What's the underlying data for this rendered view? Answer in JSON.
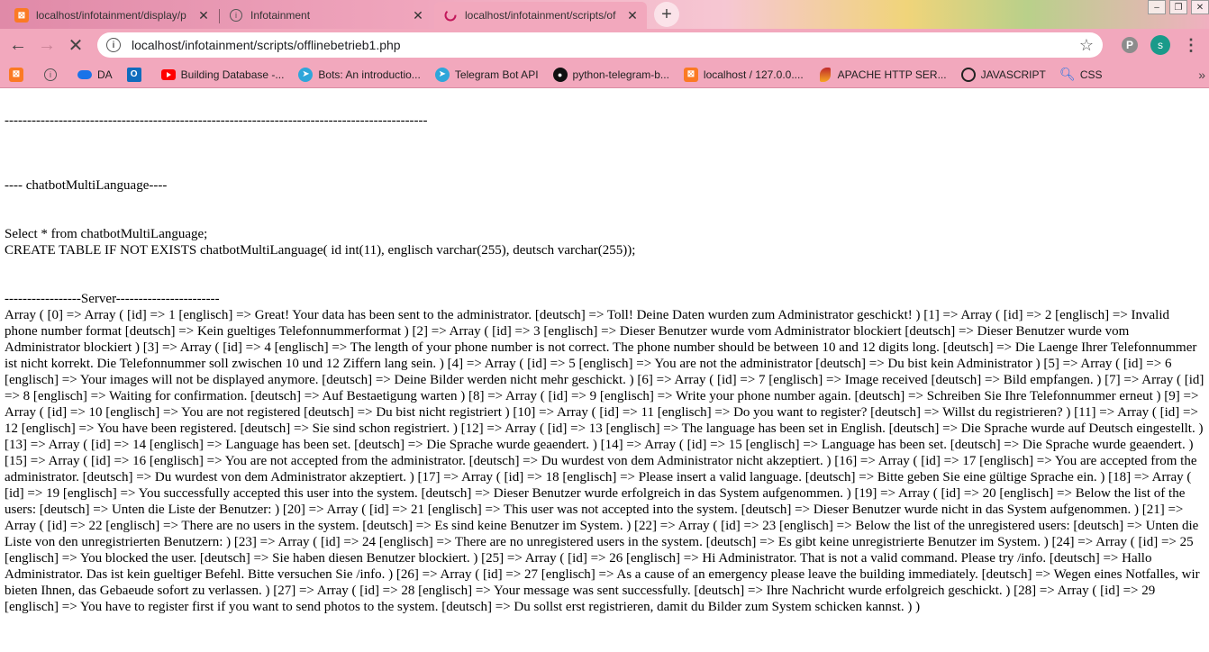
{
  "tabs": [
    {
      "title": "localhost/infotainment/display/p",
      "icon": "xampp-icon"
    },
    {
      "title": "Infotainment",
      "icon": "info-icon"
    },
    {
      "title": "localhost/infotainment/scripts/of",
      "icon": "loading-icon"
    }
  ],
  "toolbar": {
    "url": "localhost/infotainment/scripts/offlinebetrieb1.php",
    "avatar_letter": "s"
  },
  "bookmarks": [
    {
      "label": "",
      "icon": "xampp-icon"
    },
    {
      "label": "",
      "icon": "info-icon"
    },
    {
      "label": "DA",
      "icon": "cloud-icon"
    },
    {
      "label": "",
      "icon": "outlook-icon"
    },
    {
      "label": "Building Database -...",
      "icon": "youtube-icon"
    },
    {
      "label": "Bots: An introductio...",
      "icon": "telegram-icon"
    },
    {
      "label": "Telegram Bot API",
      "icon": "telegram-icon"
    },
    {
      "label": "python-telegram-b...",
      "icon": "github-icon"
    },
    {
      "label": "localhost / 127.0.0....",
      "icon": "xampp-icon"
    },
    {
      "label": "APACHE HTTP SER...",
      "icon": "apache-icon"
    },
    {
      "label": "JAVASCRIPT",
      "icon": "js-icon"
    },
    {
      "label": "CSS",
      "icon": "search-icon"
    }
  ],
  "page": {
    "separator": "----------------------------------------------------------------------------------------------",
    "section_title": "---- chatbotMultiLanguage----",
    "query_select": "Select * from chatbotMultiLanguage;",
    "query_create": "CREATE TABLE IF NOT EXISTS chatbotMultiLanguage( id int(11), englisch varchar(255), deutsch varchar(255));",
    "server_label": "-----------------Server-----------------------",
    "server_output": "Array ( [0] => Array ( [id] => 1 [englisch] => Great! Your data has been sent to the administrator. [deutsch] => Toll! Deine Daten wurden zum Administrator geschickt! ) [1] => Array ( [id] => 2 [englisch] => Invalid phone number format [deutsch] => Kein gueltiges Telefonnummerformat ) [2] => Array ( [id] => 3 [englisch] => Dieser Benutzer wurde vom Administrator blockiert [deutsch] => Dieser Benutzer wurde vom Administrator blockiert ) [3] => Array ( [id] => 4 [englisch] => The length of your phone number is not correct. The phone number should be between 10 and 12 digits long. [deutsch] => Die Laenge Ihrer Telefonnummer ist nicht korrekt. Die Telefonnummer soll zwischen 10 und 12 Ziffern lang sein. ) [4] => Array ( [id] => 5 [englisch] => You are not the administrator [deutsch] => Du bist kein Administrator ) [5] => Array ( [id] => 6 [englisch] => Your images will not be displayed anymore. [deutsch] => Deine Bilder werden nicht mehr geschickt. ) [6] => Array ( [id] => 7 [englisch] => Image received [deutsch] => Bild empfangen. ) [7] => Array ( [id] => 8 [englisch] => Waiting for confirmation. [deutsch] => Auf Bestaetigung warten ) [8] => Array ( [id] => 9 [englisch] => Write your phone number again. [deutsch] => Schreiben Sie Ihre Telefonnummer erneut ) [9] => Array ( [id] => 10 [englisch] => You are not registered [deutsch] => Du bist nicht registriert ) [10] => Array ( [id] => 11 [englisch] => Do you want to register? [deutsch] => Willst du registrieren? ) [11] => Array ( [id] => 12 [englisch] => You have been registered. [deutsch] => Sie sind schon registriert. ) [12] => Array ( [id] => 13 [englisch] => The language has been set in English. [deutsch] => Die Sprache wurde auf Deutsch eingestellt. ) [13] => Array ( [id] => 14 [englisch] => Language has been set. [deutsch] => Die Sprache wurde geaendert. ) [14] => Array ( [id] => 15 [englisch] => Language has been set. [deutsch] => Die Sprache wurde geaendert. ) [15] => Array ( [id] => 16 [englisch] => You are not accepted from the administrator. [deutsch] => Du wurdest von dem Administrator nicht akzeptiert. ) [16] => Array ( [id] => 17 [englisch] => You are accepted from the administrator. [deutsch] => Du wurdest von dem Administrator akzeptiert. ) [17] => Array ( [id] => 18 [englisch] => Please insert a valid language. [deutsch] => Bitte geben Sie eine gültige Sprache ein. ) [18] => Array ( [id] => 19 [englisch] => You successfully accepted this user into the system. [deutsch] => Dieser Benutzer wurde erfolgreich in das System aufgenommen. ) [19] => Array ( [id] => 20 [englisch] => Below the list of the users: [deutsch] => Unten die Liste der Benutzer: ) [20] => Array ( [id] => 21 [englisch] => This user was not accepted into the system. [deutsch] => Dieser Benutzer wurde nicht in das System aufgenommen. ) [21] => Array ( [id] => 22 [englisch] => There are no users in the system. [deutsch] => Es sind keine Benutzer im System. ) [22] => Array ( [id] => 23 [englisch] => Below the list of the unregistered users: [deutsch] => Unten die Liste von den unregistrierten Benutzern: ) [23] => Array ( [id] => 24 [englisch] => There are no unregistered users in the system. [deutsch] => Es gibt keine unregistrierte Benutzer im System. ) [24] => Array ( [id] => 25 [englisch] => You blocked the user. [deutsch] => Sie haben diesen Benutzer blockiert. ) [25] => Array ( [id] => 26 [englisch] => Hi Administrator. That is not a valid command. Please try /info. [deutsch] => Hallo Administrator. Das ist kein gueltiger Befehl. Bitte versuchen Sie /info. ) [26] => Array ( [id] => 27 [englisch] => As a cause of an emergency please leave the building immediately. [deutsch] => Wegen eines Notfalles, wir bieten Ihnen, das Gebaeude sofort zu verlassen. ) [27] => Array ( [id] => 28 [englisch] => Your message was sent successfully. [deutsch] => Ihre Nachricht wurde erfolgreich geschickt. ) [28] => Array ( [id] => 29 [englisch] => You have to register first if you want to send photos to the system. [deutsch] => Du sollst erst registrieren, damit du Bilder zum System schicken kannst. ) )"
  }
}
